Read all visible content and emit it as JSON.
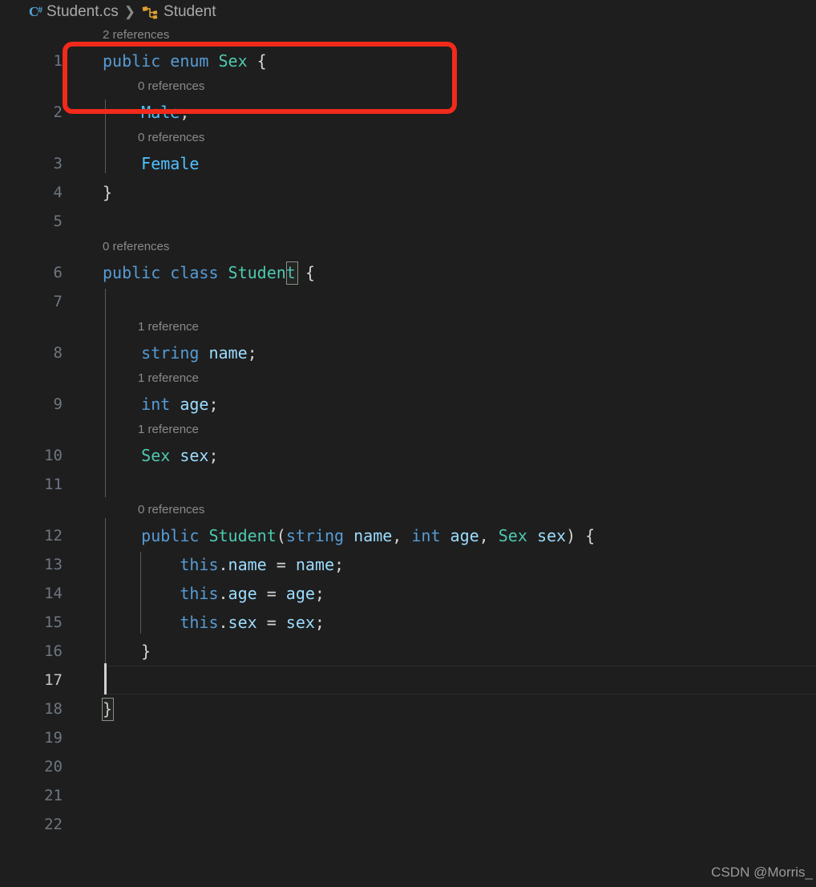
{
  "window": {
    "background": "#1e1e1e",
    "watermark": "CSDN @Morris_"
  },
  "breadcrumb": {
    "file_icon": "csharp-file-icon",
    "file_name": "Student.cs",
    "separator": "❯",
    "symbol_icon": "class-symbol-icon",
    "symbol_name": "Student"
  },
  "annotation": {
    "type": "rectangle-highlight",
    "color": "#f12a1c"
  },
  "editor": {
    "language": "csharp",
    "active_line": 17,
    "line_height_px": 36,
    "colors": {
      "background": "#1e1e1e",
      "keyword": "#569cd6",
      "type": "#4ec9b0",
      "variable": "#9cdcfe",
      "enum_member": "#4fc1ff",
      "punctuation": "#d4d4d4",
      "line_number": "#6e7681",
      "line_number_active": "#c6c6c6",
      "codelens": "#8a8a8a"
    },
    "lines": [
      {
        "num": 1,
        "lens": "2 references",
        "tokens": [
          {
            "t": "public ",
            "c": "t-key"
          },
          {
            "t": "enum ",
            "c": "t-key"
          },
          {
            "t": "Sex",
            "c": "t-type"
          },
          {
            "t": " {",
            "c": "t-pun"
          }
        ]
      },
      {
        "num": 2,
        "lens": "0 references",
        "indent": 1,
        "tokens": [
          {
            "t": "    ",
            "c": "t-pun"
          },
          {
            "t": "Male",
            "c": "t-enum"
          },
          {
            "t": ",",
            "c": "t-pun"
          }
        ]
      },
      {
        "num": 3,
        "lens": "0 references",
        "indent": 1,
        "tokens": [
          {
            "t": "    ",
            "c": "t-pun"
          },
          {
            "t": "Female",
            "c": "t-enum"
          }
        ]
      },
      {
        "num": 4,
        "lens": "",
        "tokens": [
          {
            "t": "}",
            "c": "t-pun"
          }
        ]
      },
      {
        "num": 5,
        "lens": "",
        "tokens": []
      },
      {
        "num": 6,
        "lens": "0 references",
        "tokens": [
          {
            "t": "public ",
            "c": "t-key"
          },
          {
            "t": "class ",
            "c": "t-key"
          },
          {
            "t": "Student",
            "c": "t-type"
          },
          {
            "t": " {",
            "c": "t-pun"
          }
        ]
      },
      {
        "num": 7,
        "lens": "",
        "indent": 1,
        "tokens": []
      },
      {
        "num": 8,
        "lens": "1 reference",
        "indent": 1,
        "tokens": [
          {
            "t": "    ",
            "c": "t-pun"
          },
          {
            "t": "string",
            "c": "t-key"
          },
          {
            "t": " ",
            "c": "t-pun"
          },
          {
            "t": "name",
            "c": "t-var"
          },
          {
            "t": ";",
            "c": "t-pun"
          }
        ]
      },
      {
        "num": 9,
        "lens": "1 reference",
        "indent": 1,
        "tokens": [
          {
            "t": "    ",
            "c": "t-pun"
          },
          {
            "t": "int",
            "c": "t-key"
          },
          {
            "t": " ",
            "c": "t-pun"
          },
          {
            "t": "age",
            "c": "t-var"
          },
          {
            "t": ";",
            "c": "t-pun"
          }
        ]
      },
      {
        "num": 10,
        "lens": "1 reference",
        "indent": 1,
        "tokens": [
          {
            "t": "    ",
            "c": "t-pun"
          },
          {
            "t": "Sex",
            "c": "t-type"
          },
          {
            "t": " ",
            "c": "t-pun"
          },
          {
            "t": "sex",
            "c": "t-var"
          },
          {
            "t": ";",
            "c": "t-pun"
          }
        ]
      },
      {
        "num": 11,
        "lens": "",
        "indent": 1,
        "tokens": []
      },
      {
        "num": 12,
        "lens": "0 references",
        "indent": 1,
        "tokens": [
          {
            "t": "    ",
            "c": "t-pun"
          },
          {
            "t": "public ",
            "c": "t-key"
          },
          {
            "t": "Student",
            "c": "t-type"
          },
          {
            "t": "(",
            "c": "t-pun"
          },
          {
            "t": "string",
            "c": "t-key"
          },
          {
            "t": " ",
            "c": "t-pun"
          },
          {
            "t": "name",
            "c": "t-var"
          },
          {
            "t": ", ",
            "c": "t-pun"
          },
          {
            "t": "int",
            "c": "t-key"
          },
          {
            "t": " ",
            "c": "t-pun"
          },
          {
            "t": "age",
            "c": "t-var"
          },
          {
            "t": ", ",
            "c": "t-pun"
          },
          {
            "t": "Sex",
            "c": "t-type"
          },
          {
            "t": " ",
            "c": "t-pun"
          },
          {
            "t": "sex",
            "c": "t-var"
          },
          {
            "t": ") {",
            "c": "t-pun"
          }
        ]
      },
      {
        "num": 13,
        "lens": "",
        "indent": 2,
        "tokens": [
          {
            "t": "        ",
            "c": "t-pun"
          },
          {
            "t": "this",
            "c": "t-key"
          },
          {
            "t": ".",
            "c": "t-pun"
          },
          {
            "t": "name",
            "c": "t-var"
          },
          {
            "t": " = ",
            "c": "t-pun"
          },
          {
            "t": "name",
            "c": "t-var"
          },
          {
            "t": ";",
            "c": "t-pun"
          }
        ]
      },
      {
        "num": 14,
        "lens": "",
        "indent": 2,
        "tokens": [
          {
            "t": "        ",
            "c": "t-pun"
          },
          {
            "t": "this",
            "c": "t-key"
          },
          {
            "t": ".",
            "c": "t-pun"
          },
          {
            "t": "age",
            "c": "t-var"
          },
          {
            "t": " = ",
            "c": "t-pun"
          },
          {
            "t": "age",
            "c": "t-var"
          },
          {
            "t": ";",
            "c": "t-pun"
          }
        ]
      },
      {
        "num": 15,
        "lens": "",
        "indent": 2,
        "tokens": [
          {
            "t": "        ",
            "c": "t-pun"
          },
          {
            "t": "this",
            "c": "t-key"
          },
          {
            "t": ".",
            "c": "t-pun"
          },
          {
            "t": "sex",
            "c": "t-var"
          },
          {
            "t": " = ",
            "c": "t-pun"
          },
          {
            "t": "sex",
            "c": "t-var"
          },
          {
            "t": ";",
            "c": "t-pun"
          }
        ]
      },
      {
        "num": 16,
        "lens": "",
        "indent": 2,
        "tokens": [
          {
            "t": "    ",
            "c": "t-pun"
          },
          {
            "t": "}",
            "c": "t-pun"
          }
        ]
      },
      {
        "num": 17,
        "lens": "",
        "indent": 1,
        "active": true,
        "tokens": []
      },
      {
        "num": 18,
        "lens": "",
        "tokens": [
          {
            "t": "}",
            "c": "t-pun"
          }
        ]
      },
      {
        "num": 19,
        "lens": "",
        "tokens": []
      },
      {
        "num": 20,
        "lens": "",
        "tokens": []
      },
      {
        "num": 21,
        "lens": "",
        "tokens": []
      },
      {
        "num": 22,
        "lens": "",
        "tokens": []
      }
    ]
  }
}
